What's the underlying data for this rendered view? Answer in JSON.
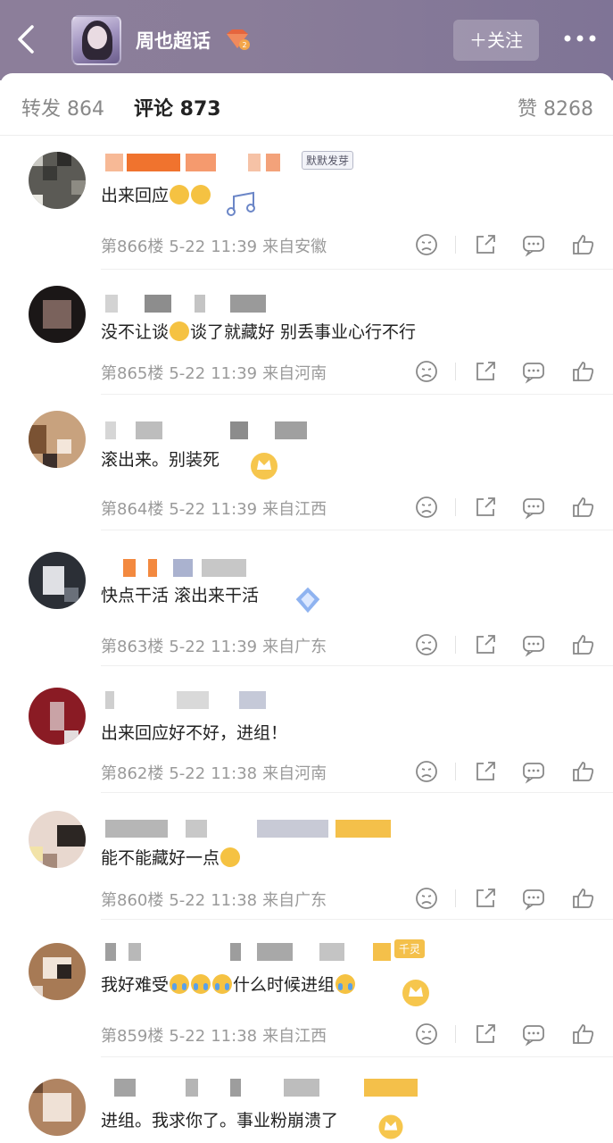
{
  "header": {
    "title": "周也超话",
    "follow_label": "＋关注",
    "back_icon": "chevron-left-icon",
    "more_icon": "more-dots-icon"
  },
  "tabs": {
    "repost": "转发 864",
    "comment": "评论 873",
    "like": "赞 8268"
  },
  "comments": [
    {
      "badge": "默默发芽",
      "text": "出来回应",
      "emoji": [
        "hug",
        "hug"
      ],
      "floor": "第866楼",
      "date": "5-22",
      "time": "11:39",
      "location": "来自安徽"
    },
    {
      "badge": "",
      "text_pre": "没不让谈",
      "text_post": "谈了就藏好 别丢事业心行不行",
      "floor": "第865楼",
      "date": "5-22",
      "time": "11:39",
      "location": "来自河南"
    },
    {
      "badge": "",
      "text": "滚出来。别装死",
      "floor": "第864楼",
      "date": "5-22",
      "time": "11:39",
      "location": "来自江西"
    },
    {
      "badge": "",
      "text": "快点干活 滚出来干活",
      "floor": "第863楼",
      "date": "5-22",
      "time": "11:39",
      "location": "来自广东"
    },
    {
      "badge": "",
      "text": "出来回应好不好，进组！",
      "floor": "第862楼",
      "date": "5-22",
      "time": "11:38",
      "location": "来自河南"
    },
    {
      "badge": "",
      "text": "能不能藏好一点",
      "floor": "第860楼",
      "date": "5-22",
      "time": "11:38",
      "location": "来自广东"
    },
    {
      "badge": "千灵",
      "text_pre": "我好难受",
      "text_post": "什么时候进组",
      "floor": "第859楼",
      "date": "5-22",
      "time": "11:38",
      "location": "来自江西"
    },
    {
      "badge": "",
      "text": "进组。我求你了。事业粉崩溃了"
    }
  ],
  "colors": {
    "header_bg": "#8a7d99",
    "meta_text": "#9a9a9a",
    "body_text": "#222222"
  }
}
